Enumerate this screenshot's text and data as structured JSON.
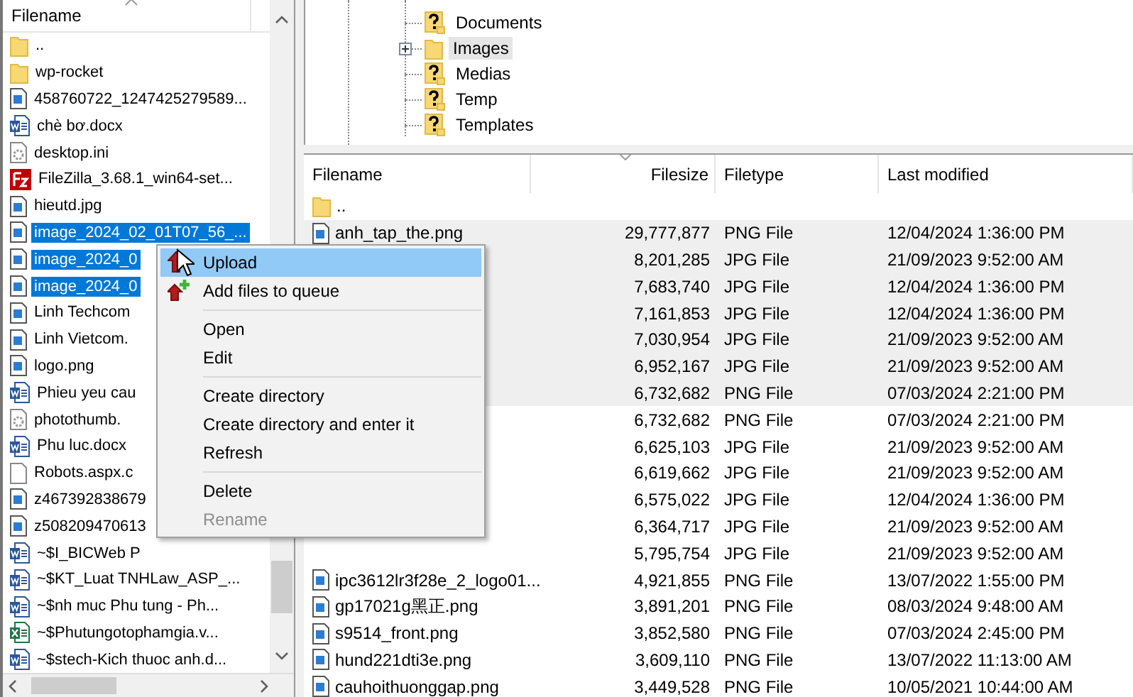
{
  "local_pane": {
    "column": "Filename",
    "files": [
      {
        "name": "..",
        "kind": "folder",
        "selected": false
      },
      {
        "name": "wp-rocket",
        "kind": "folder",
        "selected": false
      },
      {
        "name": "458760722_1247425279589...",
        "kind": "image",
        "selected": false
      },
      {
        "name": "chè bơ.docx",
        "kind": "word",
        "selected": false
      },
      {
        "name": "desktop.ini",
        "kind": "settings",
        "selected": false
      },
      {
        "name": "FileZilla_3.68.1_win64-set...",
        "kind": "app",
        "selected": false
      },
      {
        "name": "hieutd.jpg",
        "kind": "image",
        "selected": false
      },
      {
        "name": "image_2024_02_01T07_56_...",
        "kind": "image",
        "selected": true
      },
      {
        "name": "image_2024_0",
        "kind": "image",
        "selected": true
      },
      {
        "name": "image_2024_0",
        "kind": "image",
        "selected": true
      },
      {
        "name": "Linh Techcom",
        "kind": "image",
        "selected": false
      },
      {
        "name": "Linh Vietcom.",
        "kind": "image",
        "selected": false
      },
      {
        "name": "logo.png",
        "kind": "image",
        "selected": false
      },
      {
        "name": "Phieu yeu cau",
        "kind": "word",
        "selected": false
      },
      {
        "name": "photothumb.",
        "kind": "settings",
        "selected": false
      },
      {
        "name": "Phu luc.docx",
        "kind": "word",
        "selected": false
      },
      {
        "name": "Robots.aspx.c",
        "kind": "blank",
        "selected": false
      },
      {
        "name": "z467392838679",
        "kind": "image",
        "selected": false
      },
      {
        "name": "z508209470613",
        "kind": "image",
        "selected": false
      },
      {
        "name": "~$I_BICWeb P",
        "kind": "word",
        "selected": false
      },
      {
        "name": "~$KT_Luat TNHLaw_ASP_...",
        "kind": "word",
        "selected": false
      },
      {
        "name": "~$nh muc Phu tung - Ph...",
        "kind": "word",
        "selected": false
      },
      {
        "name": "~$Phutungotophamgia.v...",
        "kind": "excel",
        "selected": false
      },
      {
        "name": "~$stech-Kich thuoc anh.d...",
        "kind": "word",
        "selected": false
      }
    ]
  },
  "remote_tree": {
    "items": [
      {
        "label": "Documents",
        "kind": "unknown",
        "expandable": false,
        "selected": false
      },
      {
        "label": "Images",
        "kind": "folder",
        "expandable": true,
        "selected": true
      },
      {
        "label": "Medias",
        "kind": "unknown",
        "expandable": false,
        "selected": false
      },
      {
        "label": "Temp",
        "kind": "unknown",
        "expandable": false,
        "selected": false
      },
      {
        "label": "Templates",
        "kind": "unknown",
        "expandable": false,
        "selected": false
      }
    ]
  },
  "remote_list": {
    "columns": [
      "Filename",
      "Filesize",
      "Filetype",
      "Last modified"
    ],
    "rows": [
      {
        "kind": "folder",
        "name": "..",
        "selected": false
      },
      {
        "kind": "image",
        "name": "anh_tap_the.png",
        "filesize": "29,777,877",
        "filetype": "PNG File",
        "last_modified": "12/04/2024 1:36:00 PM",
        "selected": true
      },
      {
        "kind": "hidden",
        "filesize": "8,201,285",
        "filetype": "JPG File",
        "last_modified": "21/09/2023 9:52:00 AM",
        "selected": true
      },
      {
        "kind": "hidden",
        "filesize": "7,683,740",
        "filetype": "JPG File",
        "last_modified": "12/04/2024 1:36:00 PM",
        "selected": true
      },
      {
        "kind": "hidden",
        "filesize": "7,161,853",
        "filetype": "JPG File",
        "last_modified": "12/04/2024 1:36:00 PM",
        "selected": true
      },
      {
        "kind": "hidden",
        "filesize": "7,030,954",
        "filetype": "JPG File",
        "last_modified": "21/09/2023 9:52:00 AM",
        "selected": true
      },
      {
        "kind": "hidden",
        "filesize": "6,952,167",
        "filetype": "JPG File",
        "last_modified": "21/09/2023 9:52:00 AM",
        "selected": true
      },
      {
        "kind": "hidden",
        "filesize": "6,732,682",
        "filetype": "PNG File",
        "last_modified": "07/03/2024 2:21:00 PM",
        "selected": true
      },
      {
        "kind": "hidden",
        "filesize": "6,732,682",
        "filetype": "PNG File",
        "last_modified": "07/03/2024 2:21:00 PM",
        "selected": false
      },
      {
        "kind": "hidden",
        "filesize": "6,625,103",
        "filetype": "JPG File",
        "last_modified": "21/09/2023 9:52:00 AM",
        "selected": false
      },
      {
        "kind": "hidden",
        "filesize": "6,619,662",
        "filetype": "JPG File",
        "last_modified": "21/09/2023 9:52:00 AM",
        "selected": false
      },
      {
        "kind": "hidden",
        "filesize": "6,575,022",
        "filetype": "JPG File",
        "last_modified": "12/04/2024 1:36:00 PM",
        "selected": false
      },
      {
        "kind": "hidden",
        "filesize": "6,364,717",
        "filetype": "JPG File",
        "last_modified": "21/09/2023 9:52:00 AM",
        "selected": false
      },
      {
        "kind": "hidden",
        "filesize": "5,795,754",
        "filetype": "JPG File",
        "last_modified": "21/09/2023 9:52:00 AM",
        "selected": false
      },
      {
        "kind": "image",
        "name": "ipc3612lr3f28e_2_logo01...",
        "filesize": "4,921,855",
        "filetype": "PNG File",
        "last_modified": "13/07/2022 1:55:00 PM",
        "selected": false
      },
      {
        "kind": "image",
        "name": "gp17021g黑正.png",
        "filesize": "3,891,201",
        "filetype": "PNG File",
        "last_modified": "08/03/2024 9:48:00 AM",
        "selected": false
      },
      {
        "kind": "image",
        "name": "s9514_front.png",
        "filesize": "3,852,580",
        "filetype": "PNG File",
        "last_modified": "07/03/2024 2:45:00 PM",
        "selected": false
      },
      {
        "kind": "image",
        "name": "hund221dti3e.png",
        "filesize": "3,609,110",
        "filetype": "PNG File",
        "last_modified": "13/07/2022 11:13:00 AM",
        "selected": false
      },
      {
        "kind": "image",
        "name": "cauhoithuonggap.png",
        "filesize": "3,449,528",
        "filetype": "PNG File",
        "last_modified": "10/05/2021 10:44:00 AM",
        "selected": false
      }
    ]
  },
  "context_menu": {
    "items": [
      {
        "kind": "item",
        "label": "Upload",
        "highlighted": true,
        "disabled": false
      },
      {
        "kind": "item",
        "label": "Add files to queue",
        "highlighted": false,
        "disabled": false
      },
      {
        "kind": "separator"
      },
      {
        "kind": "item",
        "label": "Open",
        "highlighted": false,
        "disabled": false
      },
      {
        "kind": "item",
        "label": "Edit",
        "highlighted": false,
        "disabled": false
      },
      {
        "kind": "separator"
      },
      {
        "kind": "item",
        "label": "Create directory",
        "highlighted": false,
        "disabled": false
      },
      {
        "kind": "item",
        "label": "Create directory and enter it",
        "highlighted": false,
        "disabled": false
      },
      {
        "kind": "item",
        "label": "Refresh",
        "highlighted": false,
        "disabled": false
      },
      {
        "kind": "separator"
      },
      {
        "kind": "item",
        "label": "Delete",
        "highlighted": false,
        "disabled": false
      },
      {
        "kind": "item",
        "label": "Rename",
        "highlighted": false,
        "disabled": true
      }
    ]
  }
}
